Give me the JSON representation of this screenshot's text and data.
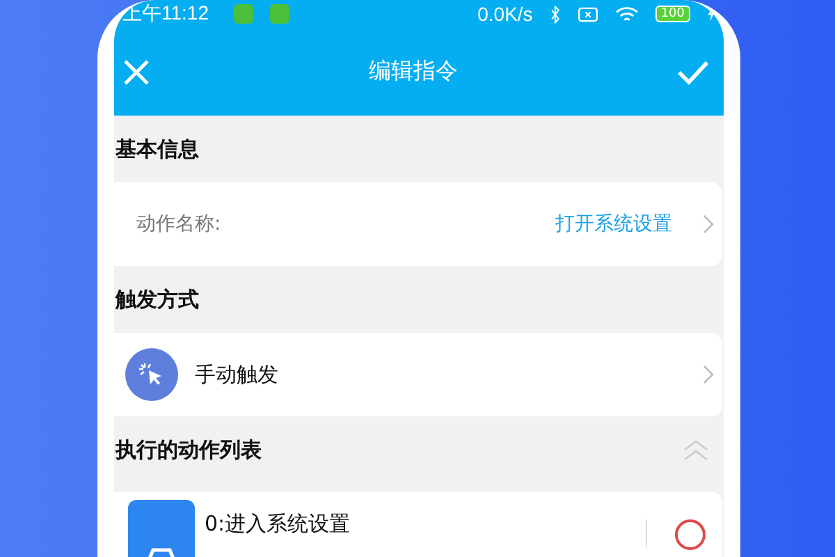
{
  "status_bar": {
    "time": "上午11:12",
    "speed": "0.0K/s",
    "battery": "100"
  },
  "app_bar": {
    "title": "编辑指令"
  },
  "sections": [
    {
      "header": "基本信息",
      "kind": "field",
      "label": "动作名称:",
      "value": "打开系统设置"
    },
    {
      "header": "触发方式",
      "kind": "trigger",
      "label": "手动触发"
    },
    {
      "header": "执行的动作列表",
      "kind": "actions",
      "expanded": true,
      "items": [
        {
          "label": "0:进入系统设置"
        }
      ]
    }
  ]
}
